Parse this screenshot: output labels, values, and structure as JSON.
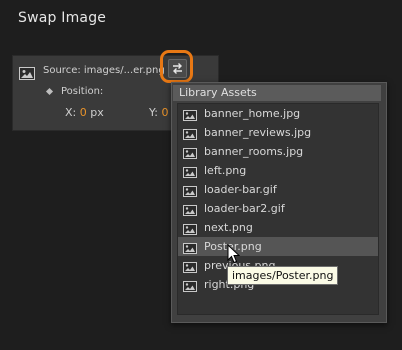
{
  "title": "Swap Image",
  "panel": {
    "source_label": "Source: images/...er.png",
    "position_label": "Position:",
    "x_label": "X:",
    "x_value": "0",
    "x_unit": "px",
    "y_label": "Y:",
    "y_value": "0"
  },
  "dropdown": {
    "header": "Library Assets",
    "items": [
      {
        "label": "banner_home.jpg"
      },
      {
        "label": "banner_reviews.jpg"
      },
      {
        "label": "banner_rooms.jpg"
      },
      {
        "label": "left.png"
      },
      {
        "label": "loader-bar.gif"
      },
      {
        "label": "loader-bar2.gif"
      },
      {
        "label": "next.png"
      },
      {
        "label": "Poster.png"
      },
      {
        "label": "previous.png"
      },
      {
        "label": "right.png"
      }
    ],
    "hovered_item": "Poster.png"
  },
  "tooltip": "images/Poster.png",
  "colors": {
    "accent_ring": "#e87814",
    "value": "#e8922a"
  },
  "icons": [
    "image-icon",
    "swap-icon",
    "pointer-cursor-icon"
  ]
}
